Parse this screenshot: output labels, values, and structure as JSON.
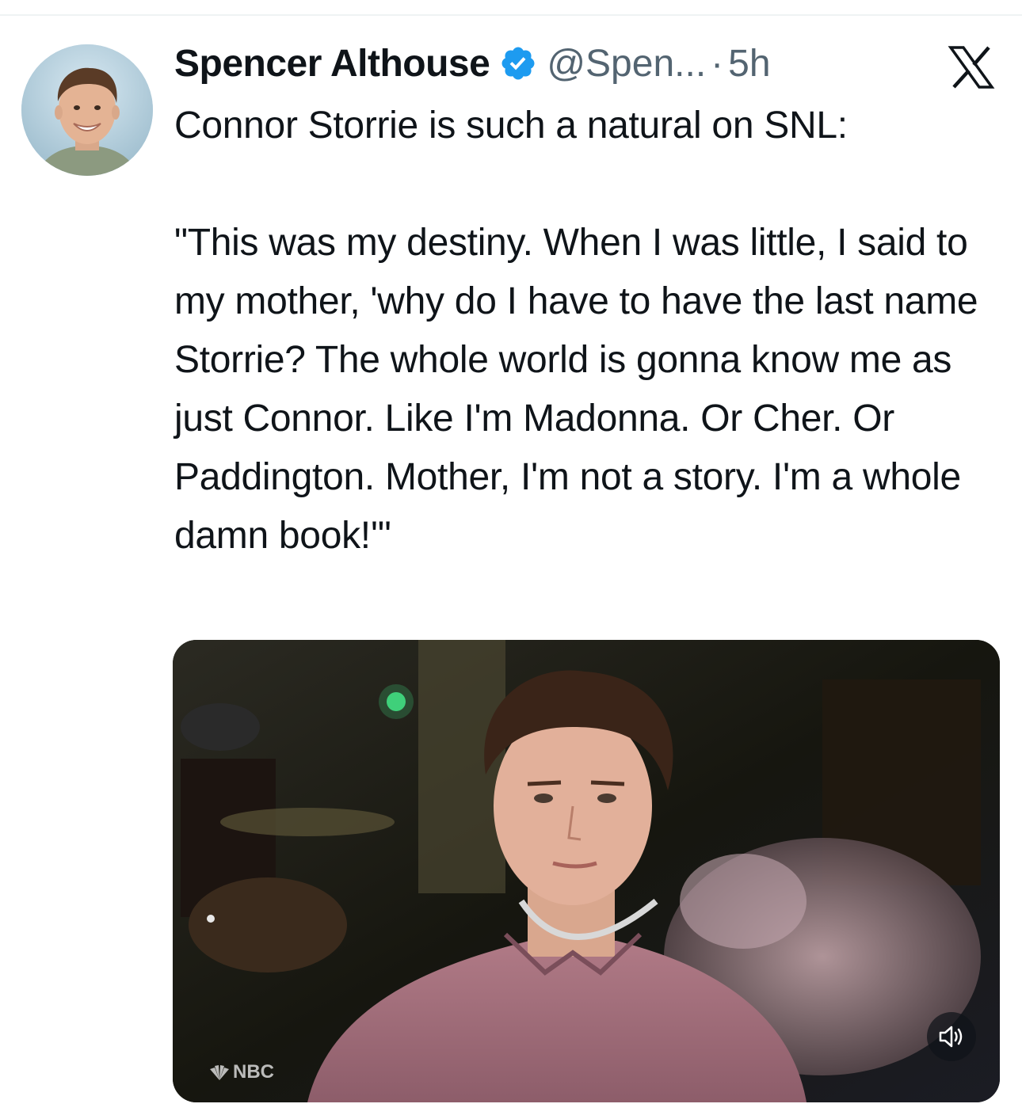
{
  "author": {
    "display_name": "Spencer Althouse",
    "handle": "@Spen...",
    "separator": "·",
    "timestamp": "5h",
    "verified": true
  },
  "tweet": {
    "text": "Connor Storrie is such a natural on SNL:\n\n\"This was my destiny. When I was little, I said to my mother, 'why do I have to have the last name Storrie? The whole world is gonna know me as just Connor. Like I'm Madonna. Or Cher. Or Paddington. Mother, I'm not a story. I'm a whole damn book!'\""
  },
  "media": {
    "type": "video",
    "watermark": "NBC",
    "volume_icon": "speaker-icon"
  },
  "icons": {
    "verified": "verified-badge-icon",
    "platform": "x-logo-icon"
  },
  "colors": {
    "verified_blue": "#1d9bf0",
    "text_primary": "#0f1419",
    "text_secondary": "#536471"
  }
}
